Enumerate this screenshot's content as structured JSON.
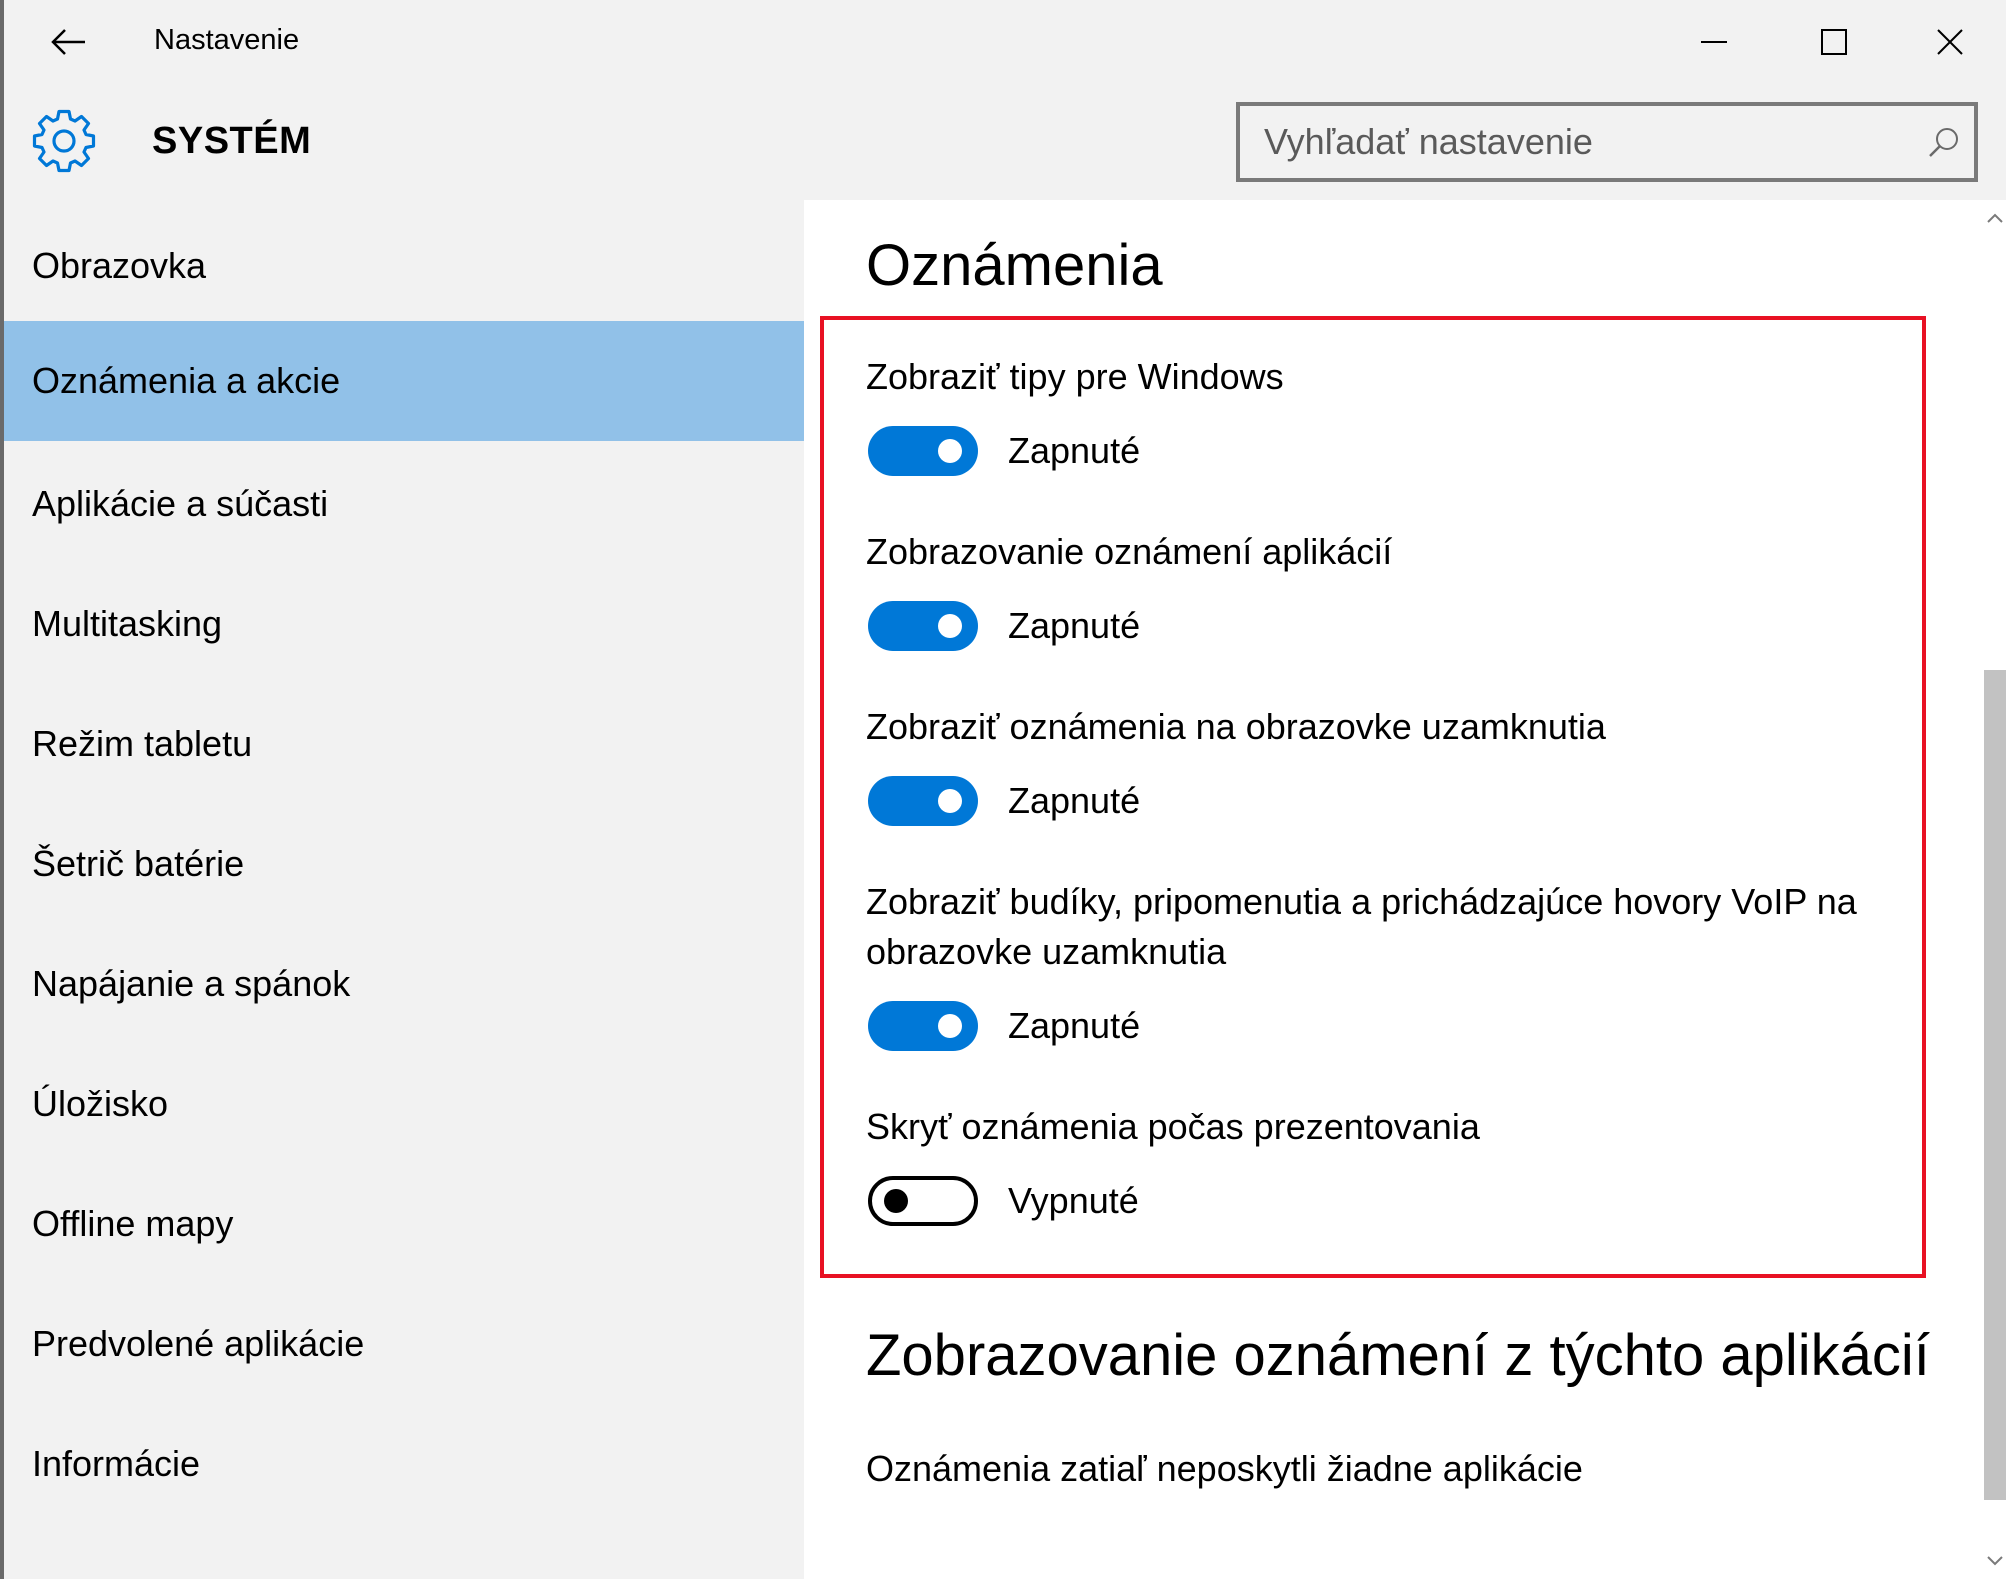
{
  "window": {
    "title": "Nastavenie"
  },
  "header": {
    "title": "SYSTÉM",
    "search_placeholder": "Vyhľadať nastavenie"
  },
  "sidebar": {
    "items": [
      {
        "label": "Obrazovka",
        "active": false
      },
      {
        "label": "Oznámenia a akcie",
        "active": true
      },
      {
        "label": "Aplikácie a súčasti",
        "active": false
      },
      {
        "label": "Multitasking",
        "active": false
      },
      {
        "label": "Režim tabletu",
        "active": false
      },
      {
        "label": "Šetrič batérie",
        "active": false
      },
      {
        "label": "Napájanie a spánok",
        "active": false
      },
      {
        "label": "Úložisko",
        "active": false
      },
      {
        "label": "Offline mapy",
        "active": false
      },
      {
        "label": "Predvolené aplikácie",
        "active": false
      },
      {
        "label": "Informácie",
        "active": false
      }
    ]
  },
  "main": {
    "section_title": "Oznámenia",
    "settings": [
      {
        "label": "Zobraziť tipy pre Windows",
        "state": "Zapnuté",
        "on": true
      },
      {
        "label": "Zobrazovanie oznámení aplikácií",
        "state": "Zapnuté",
        "on": true
      },
      {
        "label": "Zobraziť oznámenia na obrazovke uzamknutia",
        "state": "Zapnuté",
        "on": true
      },
      {
        "label": "Zobraziť budíky, pripomenutia a prichádzajúce hovory VoIP na obrazovke uzamknutia",
        "state": "Zapnuté",
        "on": true
      },
      {
        "label": "Skryť oznámenia počas prezentovania",
        "state": "Vypnuté",
        "on": false
      }
    ],
    "apps_section_title": "Zobrazovanie oznámení z týchto aplikácií",
    "apps_empty_text": "Oznámenia zatiaľ neposkytli žiadne aplikácie"
  },
  "colors": {
    "accent": "#0078d7",
    "active_nav": "#91c1e8",
    "highlight": "#e81123"
  },
  "icons": {
    "back": "back-arrow-icon",
    "minimize": "minimize-icon",
    "maximize": "maximize-icon",
    "close": "close-icon",
    "settings": "gear-icon",
    "search": "search-icon"
  }
}
